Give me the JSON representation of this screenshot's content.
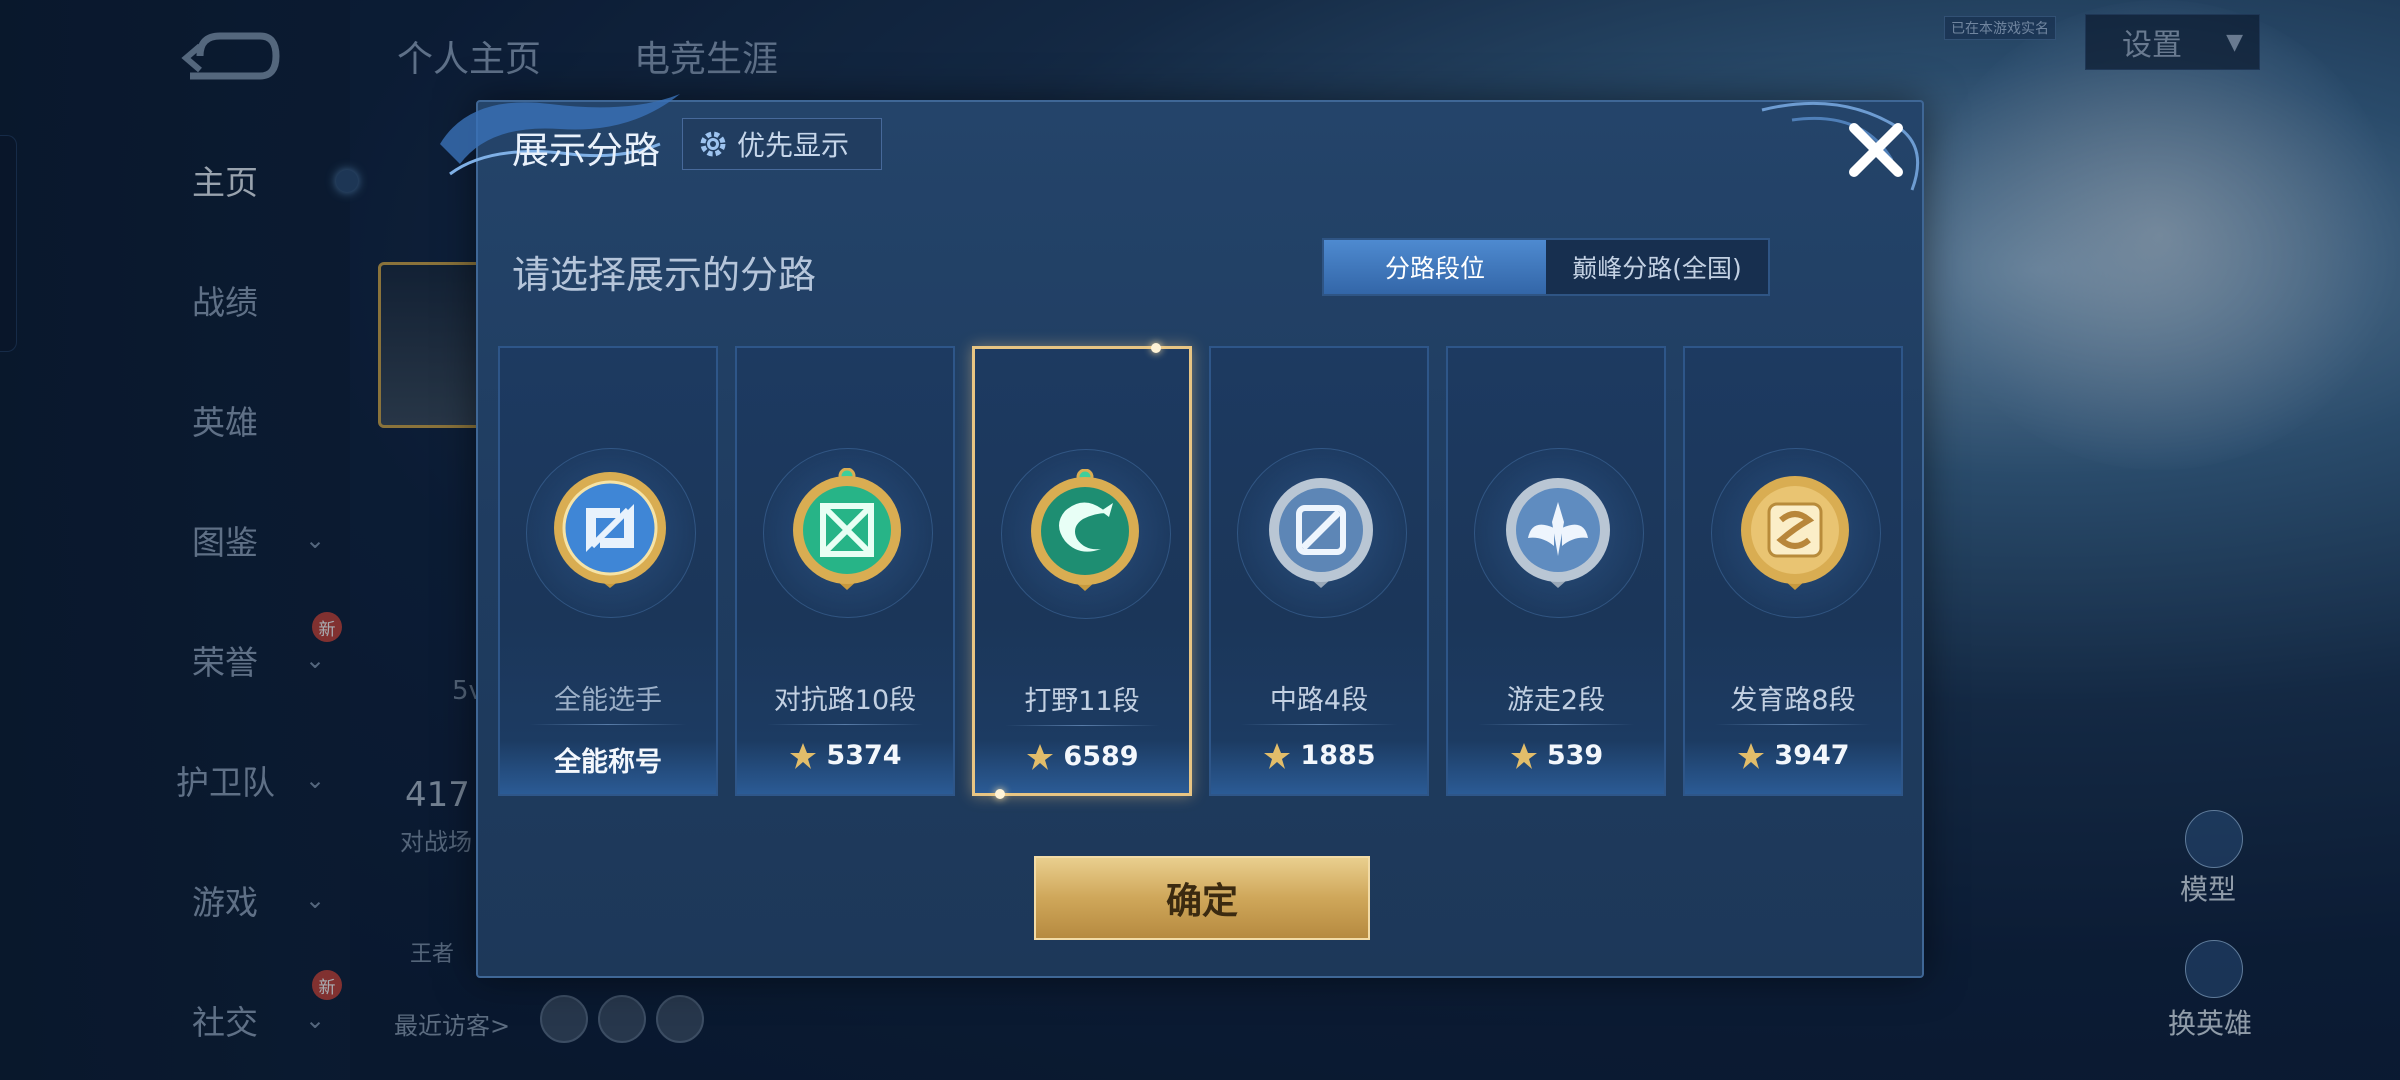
{
  "sidebar": {
    "items": [
      {
        "label": "主页",
        "chevron": false,
        "new": false
      },
      {
        "label": "战绩",
        "chevron": false,
        "new": false
      },
      {
        "label": "英雄",
        "chevron": false,
        "new": false
      },
      {
        "label": "图鉴",
        "chevron": true,
        "new": false
      },
      {
        "label": "荣誉",
        "chevron": true,
        "new": true
      },
      {
        "label": "护卫队",
        "chevron": true,
        "new": false
      },
      {
        "label": "游戏",
        "chevron": true,
        "new": false
      },
      {
        "label": "社交",
        "chevron": true,
        "new": true
      }
    ],
    "new_badge": "新"
  },
  "header": {
    "tabs": [
      "个人主页",
      "电竞生涯"
    ],
    "settings_label": "设置",
    "small_tag": "已在本游戏实名"
  },
  "background": {
    "stat_value": "417",
    "stat_sub": "对战场",
    "small_5": "5v",
    "king_label": "王者",
    "recent_visitors": "最近访客>",
    "model_label": "模型",
    "change_hero": "换英雄"
  },
  "dialog": {
    "title": "展示分路",
    "priority_button": "优先显示",
    "subtitle": "请选择展示的分路",
    "segments": [
      "分路段位",
      "巅峰分路(全国)"
    ],
    "active_segment": 0,
    "confirm": "确定",
    "cards": [
      {
        "title": "全能选手",
        "footer": "全能称号",
        "has_points_icon": false,
        "selected": false,
        "emblem": "all-round-emblem-icon"
      },
      {
        "title": "对抗路10段",
        "footer": "5374",
        "has_points_icon": true,
        "selected": false,
        "emblem": "clash-lane-emblem-icon"
      },
      {
        "title": "打野11段",
        "footer": "6589",
        "has_points_icon": true,
        "selected": true,
        "emblem": "jungle-emblem-icon"
      },
      {
        "title": "中路4段",
        "footer": "1885",
        "has_points_icon": true,
        "selected": false,
        "emblem": "mid-lane-emblem-icon"
      },
      {
        "title": "游走2段",
        "footer": "539",
        "has_points_icon": true,
        "selected": false,
        "emblem": "roam-emblem-icon"
      },
      {
        "title": "发育路8段",
        "footer": "3947",
        "has_points_icon": true,
        "selected": false,
        "emblem": "farm-lane-emblem-icon"
      }
    ]
  },
  "colors": {
    "accent_blue": "#3f77c2",
    "gold": "#d4ad62",
    "selected_border": "#e8c583"
  }
}
